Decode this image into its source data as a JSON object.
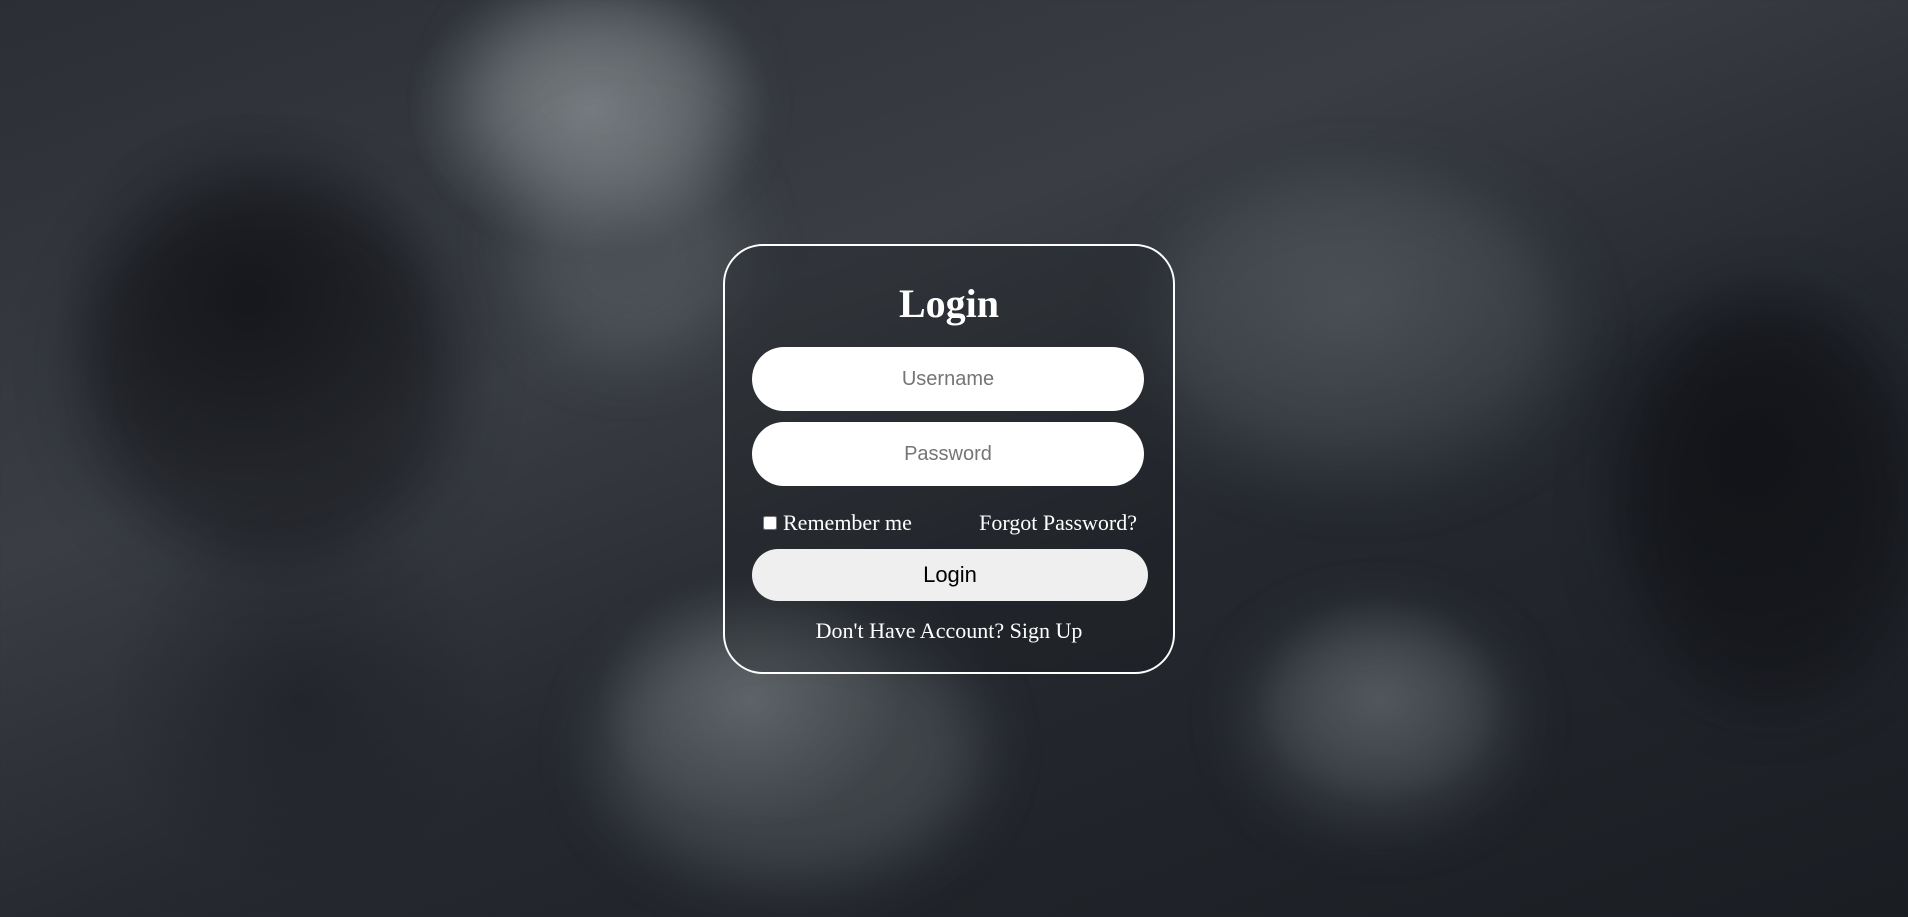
{
  "login": {
    "title": "Login",
    "username_placeholder": "Username",
    "password_placeholder": "Password",
    "remember_label": "Remember me",
    "remember_checked": false,
    "forgot_label": "Forgot Password?",
    "button_label": "Login",
    "signup_prompt": "Don't Have Account?",
    "signup_label": "Sign Up"
  },
  "theme": {
    "card_border": "#ffffff",
    "button_bg": "#efefef",
    "text_color": "#ffffff"
  }
}
